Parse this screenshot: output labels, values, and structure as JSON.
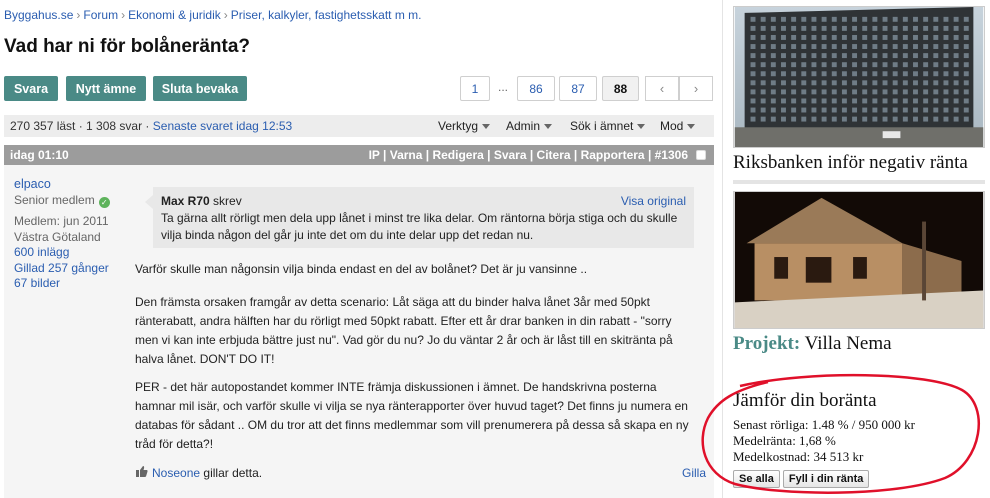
{
  "breadcrumb": [
    "Byggahus.se",
    "Forum",
    "Ekonomi & juridik",
    "Priser, kalkyler, fastighetsskatt m m."
  ],
  "page_title": "Vad har ni för bolåneränta?",
  "buttons": {
    "reply": "Svara",
    "new_topic": "Nytt ämne",
    "stop_watch": "Sluta bevaka"
  },
  "pagination": {
    "first": "1",
    "ellipsis": "...",
    "pages": [
      "86",
      "87"
    ],
    "current": "88",
    "prev_icon": "‹",
    "next_icon": "›"
  },
  "stats": {
    "text": "270 357 läst · 1 308 svar ·",
    "latest_link": "Senaste svaret idag 12:53",
    "tools": [
      "Verktyg",
      "Admin",
      "Sök i ämnet",
      "Mod"
    ]
  },
  "post": {
    "time": "idag 01:10",
    "actions": "IP | Varna | Redigera | Svara | Citera | Rapportera | #1306",
    "author": {
      "name": "elpaco",
      "rank": "Senior medlem",
      "member_since": "Medlem: jun 2011",
      "region": "Västra Götaland",
      "posts": "600 inlägg",
      "liked": "Gillad 257 gånger",
      "pictures": "67 bilder"
    },
    "quote": {
      "author": "Max R70",
      "wrote": "skrev",
      "view_original": "Visa original",
      "text": "Ta gärna allt rörligt men dela upp lånet i minst tre lika delar. Om räntorna börja stiga och du skulle vilja binda någon del går ju inte det om du inte delar upp det redan nu."
    },
    "paragraphs": [
      "Varför skulle man någonsin vilja binda endast en del av bolånet? Det är ju vansinne ..",
      "Den främsta orsaken framgår av detta scenario: Låt säga att du binder halva lånet 3år med 50pkt ränterabatt, andra hälften har du rörligt med 50pkt rabatt. Efter ett år drar banken in din rabatt - \"sorry men vi kan inte erbjuda bättre just nu\". Vad gör du nu? Jo du väntar 2 år och är låst till en skitränta på halva lånet. DON'T DO IT!",
      "PER - det här autopostandet kommer INTE främja diskussionen i ämnet. De handskrivna posterna hamnar mil isär, och varför skulle vi vilja se nya ränterapporter över huvud taget? Det finns ju numera en databas för sådant .. OM du tror att det finns medlemmar som vill prenumerera på dessa så skapa en ny tråd för detta?!"
    ],
    "likes": {
      "user": "Noseone",
      "text": "gillar detta."
    },
    "like_button": "Gilla"
  },
  "sidebar": {
    "ad1_title": "Riksbanken inför negativ ränta",
    "ad2_label": "Projekt:",
    "ad2_title": "Villa Nema",
    "rate": {
      "title": "Jämför din boränta",
      "latest": "Senast rörliga: 1.48 % / 950 000 kr",
      "average_rate": "Medelränta: 1,68 %",
      "average_cost": "Medelkostnad: 34 513 kr",
      "see_all": "Se alla",
      "fill_in": "Fyll i din ränta"
    }
  },
  "colors": {
    "accent_green": "#4a8a86",
    "link_blue": "#2a5db0",
    "annotation_red": "#e0102a"
  }
}
